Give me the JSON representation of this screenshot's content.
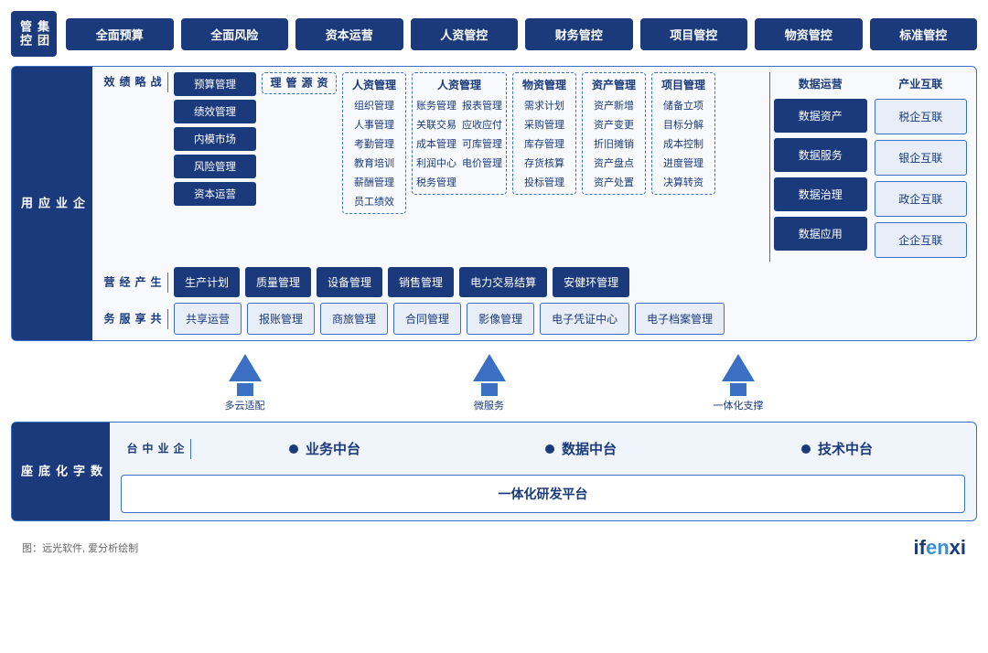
{
  "jituan": {
    "label": "集团\n管控",
    "items": [
      "全面预算",
      "全面风险",
      "资本运营",
      "人资管控",
      "财务管控",
      "项目管控",
      "物资管控",
      "标准管控"
    ]
  },
  "enterprise": {
    "label": "企\n业\n应\n用",
    "strategy": {
      "label": "战\n略\n绩\n效",
      "buttons": [
        "预算管理",
        "绩效管理",
        "内模市场",
        "风险管理",
        "资本运营"
      ]
    },
    "resource": {
      "title": "资\n源\n管\n理",
      "items": []
    },
    "groups": [
      {
        "title": "人资管理",
        "items": [
          "组织管理",
          "人事管理",
          "考勤管理",
          "教育培训",
          "薪酬管理",
          "员工绩效"
        ]
      },
      {
        "title": "人资管理",
        "subgroups": [
          {
            "title": "人资管理",
            "items": [
              "账务管理",
              "关联交易",
              "成本管理",
              "利润中心",
              "税务管理"
            ]
          },
          {
            "title": "",
            "items": [
              "报表管理",
              "应收应付",
              "可库管理",
              "电价管理"
            ]
          }
        ]
      },
      {
        "title": "物资管理",
        "items": [
          "需求计划",
          "采购管理",
          "库存管理",
          "存货核算",
          "投标管理"
        ]
      },
      {
        "title": "资产管理",
        "items": [
          "资产新增",
          "资产变更",
          "折旧摊销",
          "资产盘点",
          "资产处置"
        ]
      },
      {
        "title": "项目管理",
        "items": [
          "储备立项",
          "目标分解",
          "成本控制",
          "进度管理",
          "决算转资"
        ]
      }
    ],
    "production": {
      "label": "生\n产\n经\n营",
      "buttons": [
        "生产计划",
        "质量管理",
        "设备管理",
        "销售管理",
        "电力交易结算",
        "安健环管理"
      ]
    },
    "shared": {
      "label": "共\n享\n服\n务",
      "buttons": [
        "共享运营",
        "报账管理",
        "商旅管理",
        "合同管理",
        "影像管理",
        "电子凭证中心",
        "电子档案管理"
      ]
    },
    "data_ops": {
      "title": "数据运营",
      "buttons": [
        "数据资产",
        "数据服务",
        "数据治理",
        "数据应用"
      ]
    },
    "industry": {
      "title": "产业互联",
      "buttons": [
        "税企互联",
        "银企互联",
        "政企互联",
        "企企互联"
      ]
    }
  },
  "arrows": [
    {
      "label": "多云适配"
    },
    {
      "label": "微服务"
    },
    {
      "label": "一体化支撑"
    }
  ],
  "digital": {
    "label": "数\n字\n化\n底\n座",
    "midai_label": "企\n业\n中\n台",
    "midai_items": [
      "业务中台",
      "数据中台",
      "技术中台"
    ],
    "platform": "一体化研发平台"
  },
  "footer": {
    "note": "图：远光软件, 爱分析绘制",
    "logo": "ifenxi"
  }
}
